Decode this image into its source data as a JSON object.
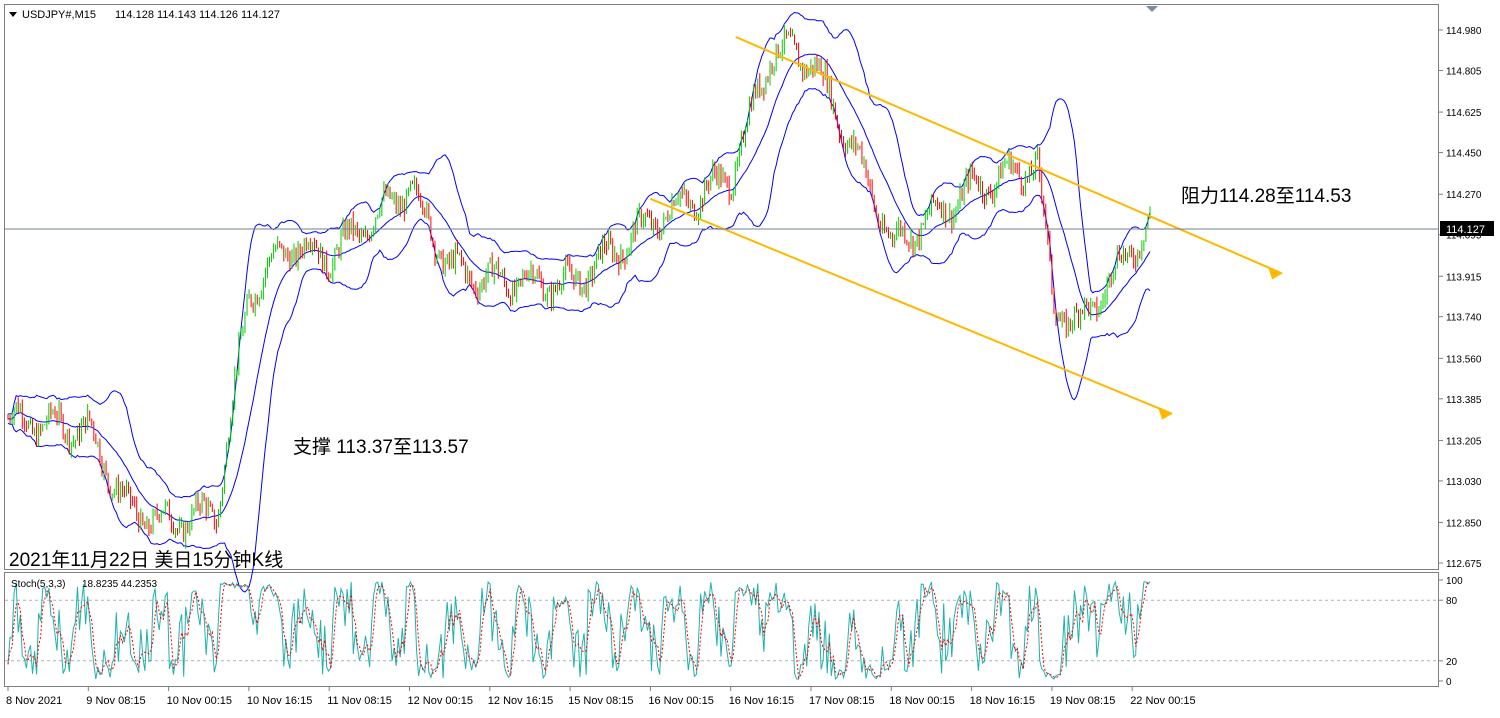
{
  "header": {
    "symbol_label": "USDJPY#,M15",
    "ohlc_values": "114.128 114.143 114.126 114.127"
  },
  "stoch_header": {
    "label": "Stoch(5,3,3)",
    "values": "18.8235 44.2353"
  },
  "annotations": {
    "resistance": "阻力114.28至114.53",
    "support": "支撑 113.37至113.57",
    "caption": "2021年11月22日 美日15分钟K线"
  },
  "colors": {
    "up_candle": "#00cc00",
    "down_candle": "#ff0000",
    "bollinger": "#0000ff",
    "channel": "#ffb800",
    "stoch_main": "#20b2aa",
    "stoch_signal": "#ff0000",
    "price_line": "#708090"
  },
  "chart_data": [
    {
      "type": "candlestick",
      "symbol": "USDJPY#",
      "timeframe": "M15",
      "current_price": "114.127",
      "y_ticks": [
        "114.980",
        "114.805",
        "114.625",
        "114.450",
        "114.270",
        "114.095",
        "113.915",
        "113.740",
        "113.560",
        "113.385",
        "113.205",
        "113.030",
        "112.850",
        "112.675"
      ],
      "y_range": [
        112.675,
        114.98
      ],
      "x_ticks": [
        "8 Nov 2021",
        "9 Nov 08:15",
        "10 Nov 00:15",
        "10 Nov 16:15",
        "11 Nov 08:15",
        "12 Nov 00:15",
        "12 Nov 16:15",
        "15 Nov 08:15",
        "16 Nov 00:15",
        "16 Nov 16:15",
        "17 Nov 08:15",
        "18 Nov 00:15",
        "18 Nov 16:15",
        "19 Nov 08:15",
        "22 Nov 00:15"
      ],
      "price_path_approx": [
        {
          "x": 0,
          "price": 113.3
        },
        {
          "x": 1,
          "price": 113.25
        },
        {
          "x": 1.5,
          "price": 112.9
        },
        {
          "x": 2,
          "price": 112.85
        },
        {
          "x": 2.6,
          "price": 112.9
        },
        {
          "x": 3,
          "price": 113.85
        },
        {
          "x": 3.5,
          "price": 114.05
        },
        {
          "x": 4,
          "price": 114.0
        },
        {
          "x": 5,
          "price": 114.3
        },
        {
          "x": 5.5,
          "price": 113.95
        },
        {
          "x": 6,
          "price": 113.9
        },
        {
          "x": 7,
          "price": 113.88
        },
        {
          "x": 8,
          "price": 114.15
        },
        {
          "x": 9,
          "price": 114.35
        },
        {
          "x": 9.5,
          "price": 114.9
        },
        {
          "x": 10,
          "price": 114.85
        },
        {
          "x": 10.6,
          "price": 114.4
        },
        {
          "x": 11,
          "price": 114.05
        },
        {
          "x": 12,
          "price": 114.3
        },
        {
          "x": 12.8,
          "price": 114.4
        },
        {
          "x": 13,
          "price": 113.8
        },
        {
          "x": 13.3,
          "price": 113.7
        },
        {
          "x": 14,
          "price": 114.05
        },
        {
          "x": 14.2,
          "price": 114.15
        }
      ],
      "channel_lines": [
        {
          "from": {
            "x": "16 Nov 16:15",
            "price": 114.95
          },
          "to": {
            "x": "22 Nov 00:15",
            "price": 114.1
          }
        },
        {
          "from": {
            "x": "16 Nov 00:15",
            "price": 114.25
          },
          "to": {
            "x": "22 Nov 00:15",
            "price": 113.45
          }
        }
      ]
    },
    {
      "type": "line",
      "name": "Stoch(5,3,3)",
      "y_ticks": [
        "100",
        "80",
        "20",
        "0"
      ],
      "y_range": [
        0,
        100
      ],
      "levels": [
        80,
        20
      ],
      "last_values": {
        "main": 18.8235,
        "signal": 44.2353
      }
    }
  ]
}
